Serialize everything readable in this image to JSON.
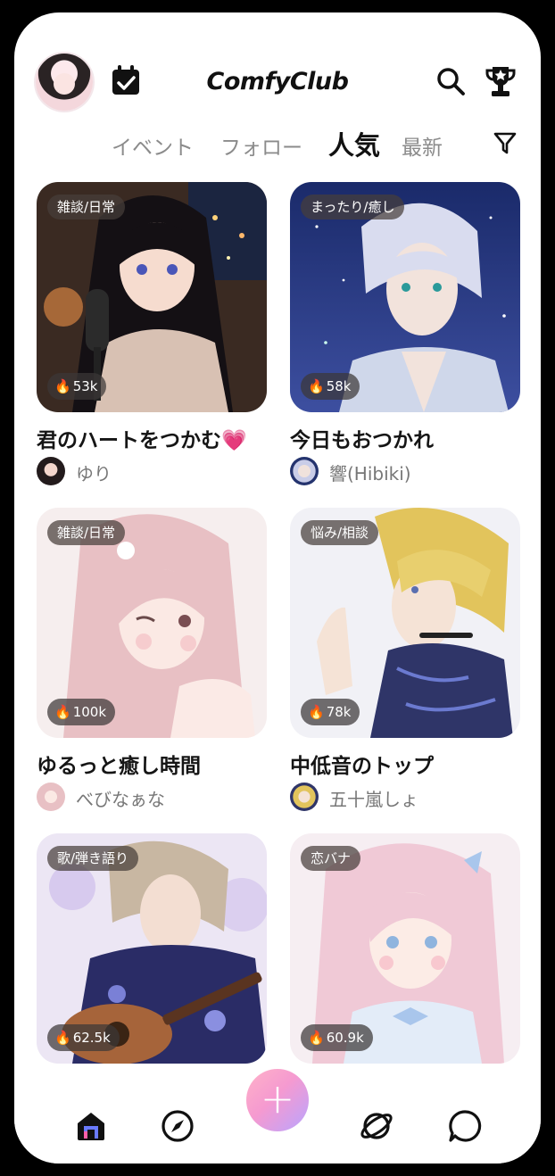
{
  "app": {
    "logo": "ComfyClub"
  },
  "tabs": [
    {
      "label": "イベント"
    },
    {
      "label": "フォロー"
    },
    {
      "label": "人気",
      "active": true
    },
    {
      "label": "最新"
    }
  ],
  "cards": [
    {
      "tag": "雑談/日常",
      "likes": "53k",
      "title": "君のハートをつかむ💗",
      "author": "ゆり"
    },
    {
      "tag": "まったり/癒し",
      "likes": "58k",
      "title": "今日もおつかれ",
      "author": "響(Hibiki)"
    },
    {
      "tag": "雑談/日常",
      "likes": "100k",
      "title": "ゆるっと癒し時間",
      "author": "べびなぁな"
    },
    {
      "tag": "悩み/相談",
      "likes": "78k",
      "title": "中低音のトップ",
      "author": "五十嵐しょ"
    },
    {
      "tag": "歌/弾き語り",
      "likes": "62.5k",
      "title": "",
      "author": ""
    },
    {
      "tag": "恋バナ",
      "likes": "60.9k",
      "title": "",
      "author": ""
    }
  ],
  "nav": {
    "items": [
      "home-icon",
      "compass-icon",
      "plus-icon",
      "planet-icon",
      "chat-icon"
    ]
  },
  "colors": {
    "accent_gradient": [
      "#ffb2c8",
      "#b9a4ff"
    ],
    "fire": "#ff6a2a",
    "tab_inactive": "#8b8b8b"
  }
}
